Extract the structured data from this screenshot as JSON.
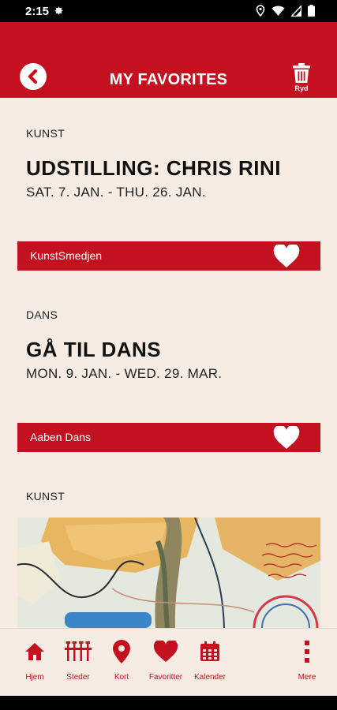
{
  "status_bar": {
    "time": "2:15"
  },
  "header": {
    "title": "MY FAVORITES",
    "clear_label": "Ryd"
  },
  "favorites": [
    {
      "category": "KUNST",
      "title": "UDSTILLING: CHRIS RINI",
      "dates": "SAT. 7. JAN. - THU. 26. JAN.",
      "venue": "KunstSmedjen"
    },
    {
      "category": "DANS",
      "title": "GÅ TIL DANS",
      "dates": "MON. 9. JAN. - WED. 29. MAR.",
      "venue": "Aaben Dans"
    },
    {
      "category": "KUNST"
    }
  ],
  "tabs": [
    {
      "label": "Hjem",
      "icon": "home-icon"
    },
    {
      "label": "Steder",
      "icon": "places-icon"
    },
    {
      "label": "Kort",
      "icon": "map-pin-icon"
    },
    {
      "label": "Favoritter",
      "icon": "heart-icon"
    },
    {
      "label": "Kalender",
      "icon": "calendar-icon"
    },
    {
      "label": "Mere",
      "icon": "more-vertical-icon"
    }
  ],
  "colors": {
    "brand_red": "#c41120",
    "background": "#f7ece3"
  }
}
